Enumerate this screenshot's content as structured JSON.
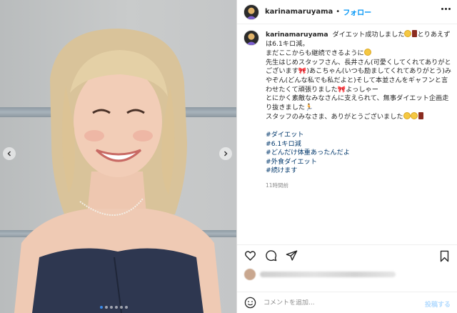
{
  "post": {
    "username": "karinamaruyama",
    "follow_label": "フォロー",
    "separator": "•",
    "caption_lines": [
      "ダイエット成功しました",
      "とりあえずは6.1キロ減。",
      "まだここからも継続できるように",
      "先生はじめスタッフさん、長井さん(可愛くしてくれてありがとございます🎀)あこちゃん(いつも励ましてくれてありがとう)みやぞん(どんな私でも私だよと)そして本並さんをギャフンと言わせたくて頑張りました🎀よっしゃー",
      "とにかく素敵なみなさんに支えられて、無事ダイエット企画走り抜きました🏃",
      "スタッフのみなさま、ありがとうございました"
    ],
    "hashtags": [
      "#ダイエット",
      "#6.1キロ減",
      "#どんだけ体重あったんだよ",
      "#外食ダイエット",
      "#続けます"
    ],
    "time_ago": "11時間前"
  },
  "comment": {
    "placeholder": "コメントを追加...",
    "post_label": "投稿する"
  },
  "icons": {
    "more": "more-options-icon",
    "like": "heart-icon",
    "comment": "comment-icon",
    "share": "share-icon",
    "save": "bookmark-icon",
    "emoji": "emoji-icon",
    "prev": "chevron-left-icon",
    "next": "chevron-right-icon"
  },
  "colors": {
    "link_blue": "#0095f6",
    "hashtag": "#00376b",
    "post_disabled": "#b3dbff"
  },
  "carousel": {
    "slide_count": 6,
    "active_index": 0
  }
}
